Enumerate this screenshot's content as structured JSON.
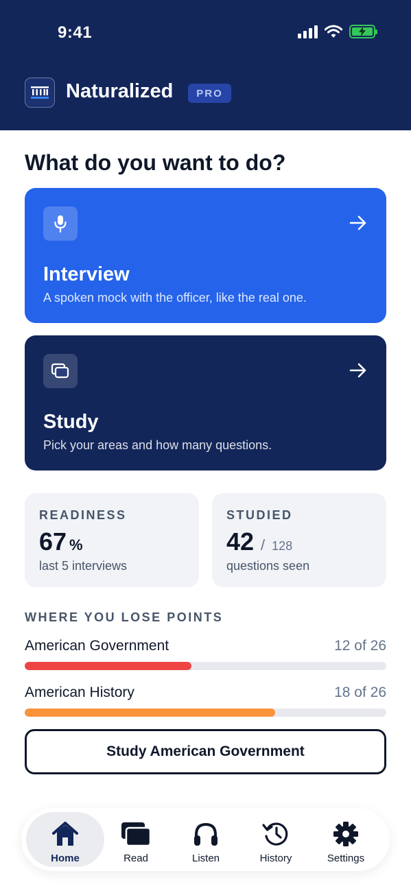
{
  "status_bar": {
    "time": "9:41"
  },
  "header": {
    "app_name": "Naturalized",
    "badge": "PRO"
  },
  "main": {
    "title": "What do you want to do?",
    "cards": [
      {
        "title": "Interview",
        "subtitle": "A spoken mock with the officer, like the real one.",
        "icon": "microphone-icon",
        "color": "#2563eb"
      },
      {
        "title": "Study",
        "subtitle": "Pick your areas and how many questions.",
        "icon": "cards-icon",
        "color": "#13265a"
      }
    ],
    "stats": {
      "readiness": {
        "label": "READINESS",
        "value": "67",
        "unit": "%",
        "caption": "last 5 interviews"
      },
      "studied": {
        "label": "STUDIED",
        "value": "42",
        "separator": "/",
        "total": "128",
        "caption": "questions seen"
      }
    },
    "losses": {
      "label": "WHERE YOU LOSE POINTS",
      "items": [
        {
          "name": "American Government",
          "score_text": "12 of 26",
          "score": 12,
          "total": 26,
          "color": "#ef4444"
        },
        {
          "name": "American History",
          "score_text": "18 of 26",
          "score": 18,
          "total": 26,
          "color": "#fb923c"
        }
      ]
    },
    "cta_label": "Study American Government"
  },
  "tabbar": {
    "items": [
      {
        "label": "Home",
        "icon": "home-icon",
        "active": true
      },
      {
        "label": "Read",
        "icon": "cards-icon",
        "active": false
      },
      {
        "label": "Listen",
        "icon": "headphones-icon",
        "active": false
      },
      {
        "label": "History",
        "icon": "history-icon",
        "active": false
      },
      {
        "label": "Settings",
        "icon": "gear-icon",
        "active": false
      }
    ]
  },
  "colors": {
    "navy": "#13265a",
    "blue": "#2563eb",
    "text": "#0f172a"
  }
}
